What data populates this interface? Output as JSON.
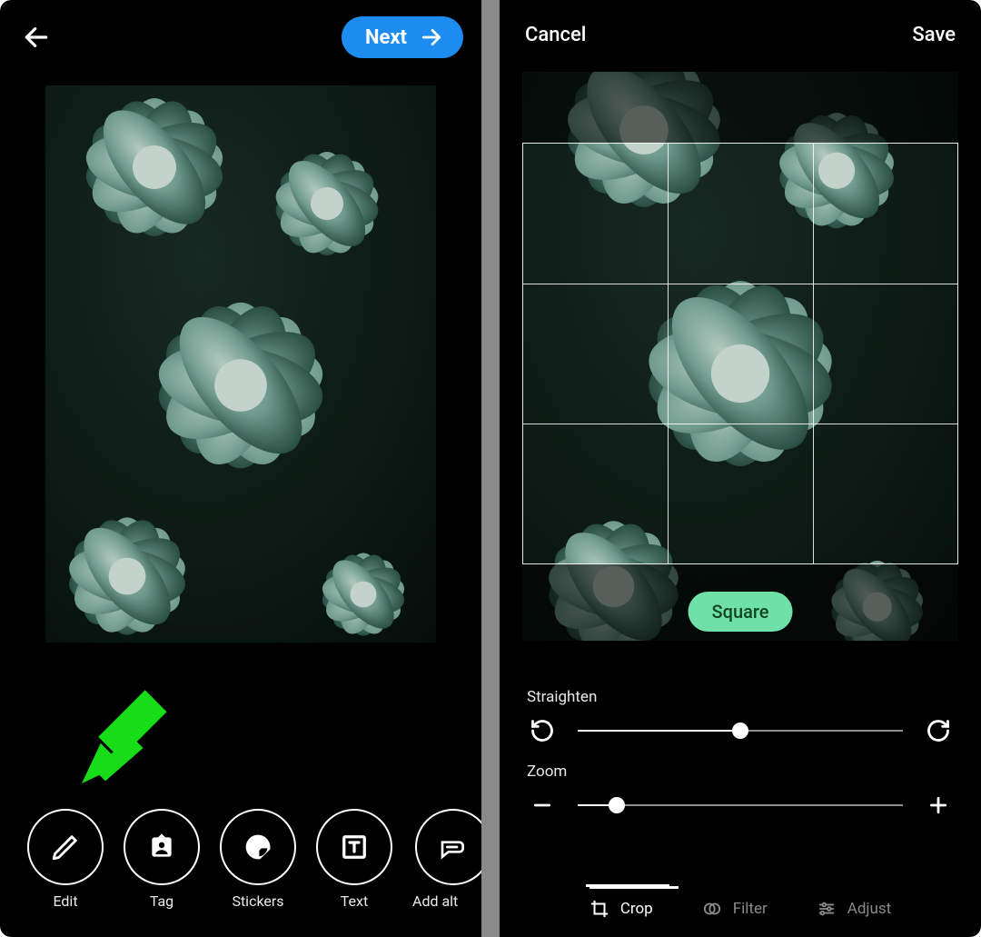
{
  "left": {
    "next_label": "Next",
    "tools": {
      "edit": "Edit",
      "tag": "Tag",
      "stickers": "Stickers",
      "text": "Text",
      "add_alt": "Add alt"
    }
  },
  "right": {
    "cancel_label": "Cancel",
    "save_label": "Save",
    "crop_shape_label": "Square",
    "sliders": {
      "straighten_label": "Straighten",
      "straighten_value_pct": 50,
      "zoom_label": "Zoom",
      "zoom_value_pct": 12
    },
    "tabs": {
      "crop": "Crop",
      "filter": "Filter",
      "adjust": "Adjust",
      "active": "crop"
    }
  },
  "colors": {
    "primary_blue": "#1d8cf0",
    "callout_green": "#18dc18",
    "pill_green": "#6fe0a8"
  }
}
